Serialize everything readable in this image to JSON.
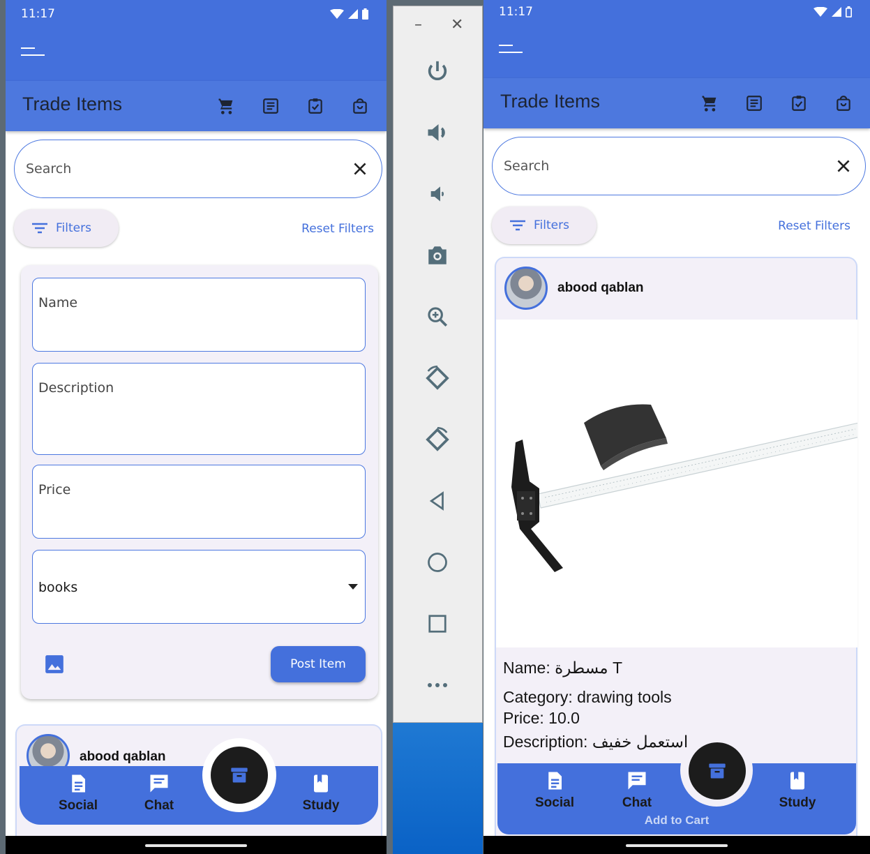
{
  "left_screen": {
    "status": {
      "time": "11:17"
    },
    "appbar": {
      "title": "Trade Items"
    },
    "search": {
      "placeholder": "Search"
    },
    "filters": {
      "filters_label": "Filters",
      "reset_label": "Reset Filters"
    },
    "form": {
      "name_label": "Name",
      "description_label": "Description",
      "price_label": "Price",
      "category_value": "books",
      "post_label": "Post Item"
    },
    "post": {
      "username": "abood qablan"
    },
    "nav": {
      "social": "Social",
      "chat": "Chat",
      "study": "Study"
    }
  },
  "right_screen": {
    "status": {
      "time": "11:17"
    },
    "appbar": {
      "title": "Trade Items"
    },
    "search": {
      "placeholder": "Search"
    },
    "filters": {
      "filters_label": "Filters",
      "reset_label": "Reset Filters"
    },
    "post": {
      "username": "abood qablan",
      "name": "Name: مسطرة T",
      "category": "Category: drawing tools",
      "price": "Price: 10.0",
      "description": "Description: استعمل خفيف",
      "add_to_cart": "Add to Cart"
    },
    "nav": {
      "social": "Social",
      "chat": "Chat",
      "study": "Study"
    }
  },
  "emulator_panel": {
    "tools": [
      "power-icon",
      "volume-up-icon",
      "volume-down-icon",
      "camera-icon",
      "zoom-icon",
      "rotate-left-icon",
      "rotate-right-icon",
      "back-icon",
      "home-icon",
      "overview-icon",
      "more-icon"
    ]
  },
  "colors": {
    "primary": "#4470dc",
    "card_bg": "#f3f0f8",
    "fab": "#1c1c1c",
    "text_dark": "#1d2433"
  }
}
